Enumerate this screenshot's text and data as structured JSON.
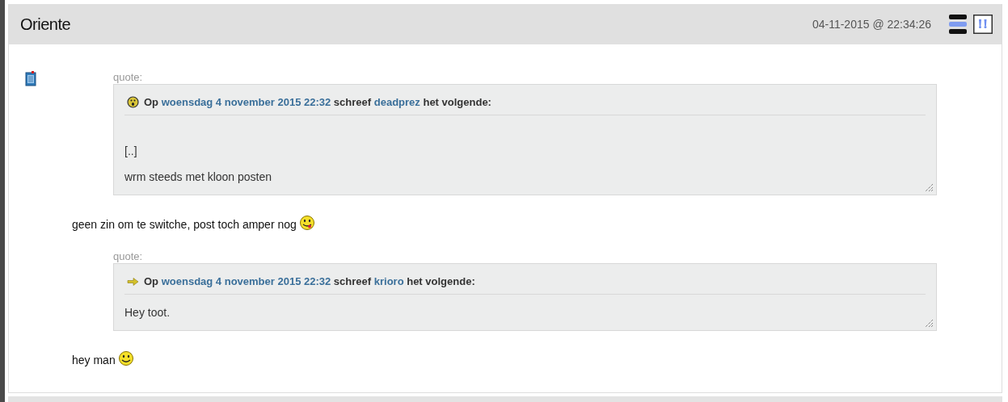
{
  "post": {
    "author": "Oriente",
    "timestamp": "04-11-2015 @ 22:34:26",
    "content": [
      {
        "kind": "quote",
        "label": "quote:",
        "op": "Op",
        "date": "woensdag 4 november 2015 22:32",
        "wrote": "schreef",
        "user": "deadprez",
        "tail": "het volgende:",
        "lines": [
          "[..]",
          "wrm steeds met kloon posten"
        ],
        "leading_gap": true
      },
      {
        "kind": "text",
        "text": "geen zin om te switche, post toch amper nog"
      },
      {
        "kind": "quote",
        "label": "quote:",
        "op": "Op",
        "date": "woensdag 4 november 2015 22:32",
        "wrote": "schreef",
        "user": "krioro",
        "tail": "het volgende:",
        "lines": [
          "Hey toot."
        ],
        "leading_gap": false
      },
      {
        "kind": "text",
        "text": "hey man"
      }
    ]
  }
}
